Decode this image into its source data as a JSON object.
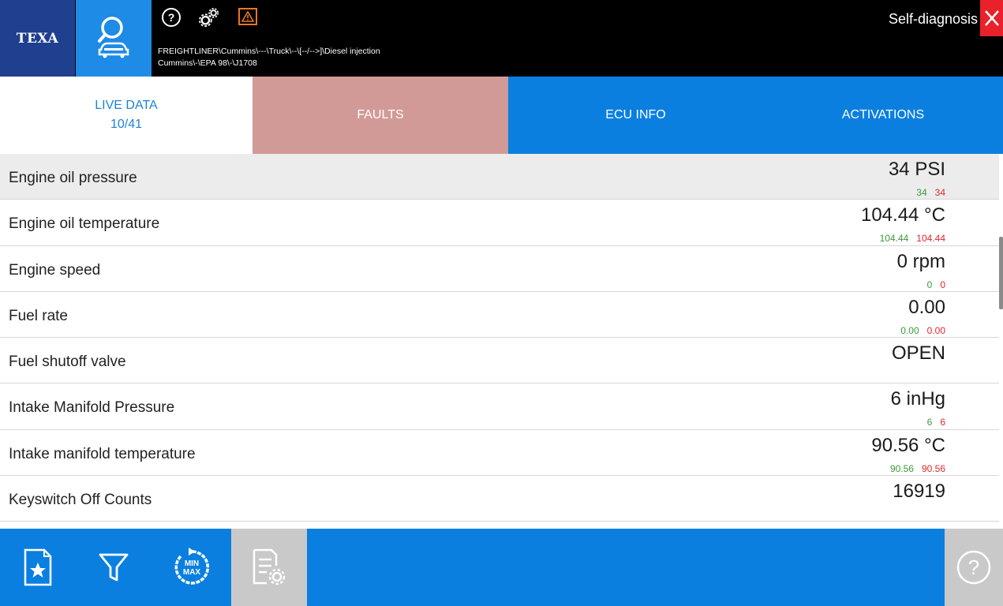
{
  "header": {
    "logo": "TEXA",
    "breadcrumb_line1": "FREIGHTLINER\\Cummins\\---\\Truck\\--\\[--/-->]\\Diesel injection",
    "breadcrumb_line2": "Cummins\\-\\EPA 98\\-\\J1708",
    "mode_title": "Self-diagnosis",
    "icons": [
      "help-icon",
      "settings-gears-icon",
      "warning-icon",
      "close-icon"
    ]
  },
  "tabs": {
    "live_data": "LIVE DATA",
    "live_data_count": "10/41",
    "faults": "FAULTS",
    "ecu_info": "ECU INFO",
    "activations": "ACTIVATIONS"
  },
  "rows": [
    {
      "label": "Engine oil pressure",
      "value": "34 PSI",
      "min": "34",
      "max": "34"
    },
    {
      "label": "Engine oil temperature",
      "value": "104.44 °C",
      "min": "104.44",
      "max": "104.44"
    },
    {
      "label": "Engine speed",
      "value": "0 rpm",
      "min": "0",
      "max": "0"
    },
    {
      "label": "Fuel rate",
      "value": "0.00",
      "min": "0.00",
      "max": "0.00"
    },
    {
      "label": "Fuel shutoff valve",
      "value": "OPEN"
    },
    {
      "label": "Intake Manifold Pressure",
      "value": "6 inHg",
      "min": "6",
      "max": "6"
    },
    {
      "label": "Intake manifold temperature",
      "value": "90.56 °C",
      "min": "90.56",
      "max": "90.56"
    },
    {
      "label": "Keyswitch Off Counts",
      "value": "16919"
    }
  ],
  "toolbar": {
    "minmax_label_top": "MIN",
    "minmax_label_bottom": "MAX",
    "icons": [
      "favorites-icon",
      "filter-icon",
      "min-max-reset-icon",
      "list-settings-icon",
      "help-icon"
    ]
  },
  "colors": {
    "brand_blue": "#1f3f8f",
    "accent_blue": "#0a7fe0",
    "faults_tab": "#d19a96",
    "min_green": "#3a9a3a",
    "max_red": "#e0282e",
    "close_red": "#e8212a"
  }
}
